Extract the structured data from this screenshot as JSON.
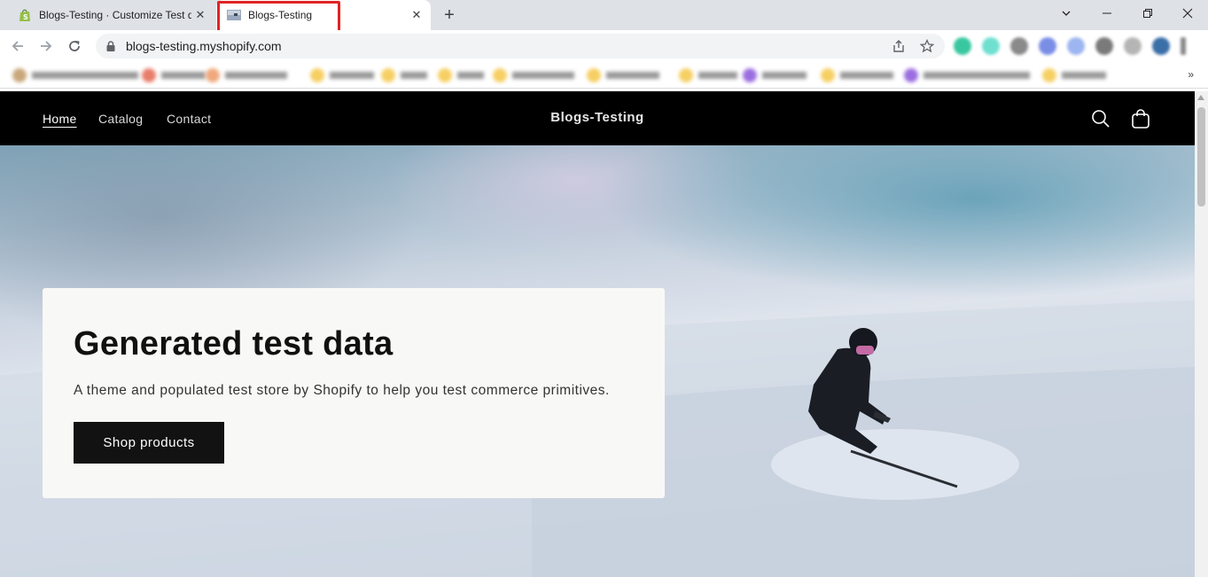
{
  "browser": {
    "tabs": [
      {
        "title": "Blogs-Testing · Customize Test da",
        "active": false,
        "favicon": "shopify-bag-icon"
      },
      {
        "title": "Blogs-Testing",
        "active": true,
        "favicon": "store-thumbnail-icon"
      }
    ],
    "new_tab_label": "+",
    "address": "blogs-testing.myshopify.com",
    "bookmarks_more": "»",
    "highlight_color": "#e02424"
  },
  "site": {
    "nav": [
      {
        "label": "Home",
        "active": true
      },
      {
        "label": "Catalog",
        "active": false
      },
      {
        "label": "Contact",
        "active": false
      }
    ],
    "brand": "Blogs-Testing",
    "header_bg": "#000000"
  },
  "hero": {
    "title": "Generated test data",
    "subtitle": "A theme and populated test store by Shopify to help you test commerce primitives.",
    "button_label": "Shop products"
  }
}
